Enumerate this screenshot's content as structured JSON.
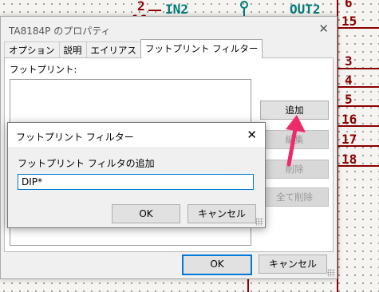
{
  "schematic": {
    "pin_labels": {
      "in2": "IN2",
      "out2": "OUT2"
    },
    "pin_numbers": [
      "2",
      "16",
      "15",
      "3",
      "4",
      "5",
      "16",
      "17",
      "18"
    ],
    "top_right_number": "6"
  },
  "properties_window": {
    "title": "TA8184P のプロパティ",
    "tabs": [
      {
        "label": "オプション"
      },
      {
        "label": "説明"
      },
      {
        "label": "エイリアス"
      },
      {
        "label": "フットプリント フィルター"
      }
    ],
    "footprint_label": "フットプリント:",
    "buttons": {
      "add": "追加",
      "edit": "編集",
      "delete": "削除",
      "delete_all": "全て削除"
    },
    "ok": "OK",
    "cancel": "キャンセル"
  },
  "filter_dialog": {
    "title": "フットプリント フィルター",
    "label": "フットプリント フィルタの追加",
    "input_value": "DIP*",
    "ok": "OK",
    "cancel": "キャンセル"
  },
  "colors": {
    "accent": "#0078d7",
    "schematic_dark_red": "#8b0000",
    "pin_label_teal": "#007a7a",
    "arrow_pink": "#ee2a6b"
  }
}
